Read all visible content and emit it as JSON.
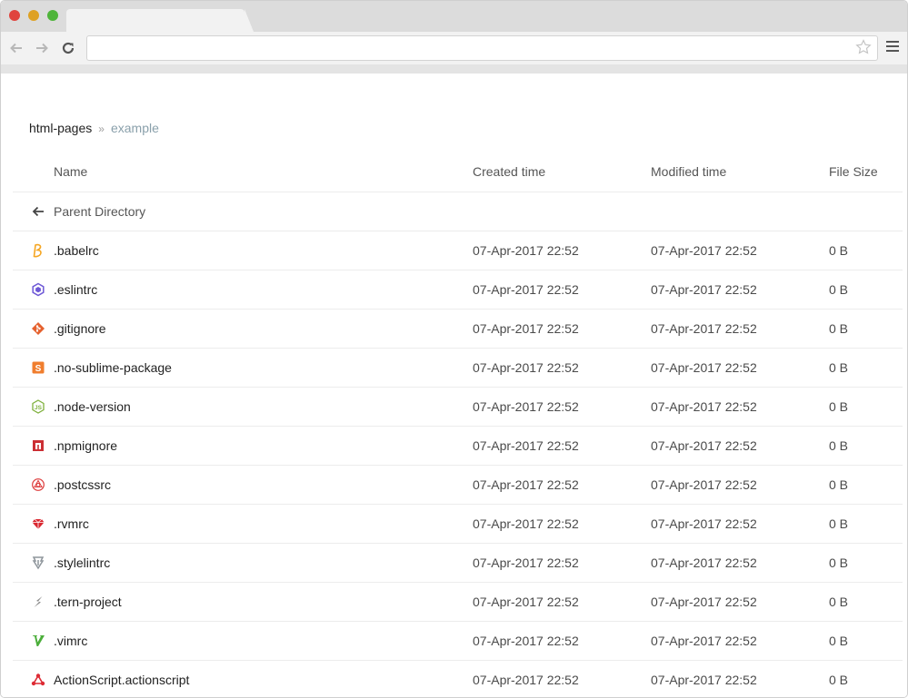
{
  "browser": {
    "url": "",
    "back_icon": "arrow-left-icon",
    "forward_icon": "arrow-right-icon",
    "reload_icon": "reload-icon",
    "star_icon": "star-icon",
    "menu_icon": "hamburger-menu-icon"
  },
  "breadcrumb": {
    "root": "html-pages",
    "separator": "»",
    "current": "example"
  },
  "table": {
    "headers": {
      "name": "Name",
      "created": "Created time",
      "modified": "Modified time",
      "size": "File Size"
    },
    "parent": {
      "label": "Parent Directory",
      "icon": "arrow-left-icon"
    },
    "rows": [
      {
        "name": ".babelrc",
        "created": "07-Apr-2017 22:52",
        "modified": "07-Apr-2017 22:52",
        "size": "0 B",
        "icon": "babel-icon",
        "color": "#f5a623"
      },
      {
        "name": ".eslintrc",
        "created": "07-Apr-2017 22:52",
        "modified": "07-Apr-2017 22:52",
        "size": "0 B",
        "icon": "eslint-icon",
        "color": "#6d58d6"
      },
      {
        "name": ".gitignore",
        "created": "07-Apr-2017 22:52",
        "modified": "07-Apr-2017 22:52",
        "size": "0 B",
        "icon": "git-icon",
        "color": "#e5612e"
      },
      {
        "name": ".no-sublime-package",
        "created": "07-Apr-2017 22:52",
        "modified": "07-Apr-2017 22:52",
        "size": "0 B",
        "icon": "sublime-icon",
        "color": "#f07e2e"
      },
      {
        "name": ".node-version",
        "created": "07-Apr-2017 22:52",
        "modified": "07-Apr-2017 22:52",
        "size": "0 B",
        "icon": "nodejs-icon",
        "color": "#7fb13d"
      },
      {
        "name": ".npmignore",
        "created": "07-Apr-2017 22:52",
        "modified": "07-Apr-2017 22:52",
        "size": "0 B",
        "icon": "npm-icon",
        "color": "#cb2f34"
      },
      {
        "name": ".postcssrc",
        "created": "07-Apr-2017 22:52",
        "modified": "07-Apr-2017 22:52",
        "size": "0 B",
        "icon": "postcss-icon",
        "color": "#dd3a3a"
      },
      {
        "name": ".rvmrc",
        "created": "07-Apr-2017 22:52",
        "modified": "07-Apr-2017 22:52",
        "size": "0 B",
        "icon": "ruby-icon",
        "color": "#d9262f"
      },
      {
        "name": ".stylelintrc",
        "created": "07-Apr-2017 22:52",
        "modified": "07-Apr-2017 22:52",
        "size": "0 B",
        "icon": "stylelint-icon",
        "color": "#8e959b"
      },
      {
        "name": ".tern-project",
        "created": "07-Apr-2017 22:52",
        "modified": "07-Apr-2017 22:52",
        "size": "0 B",
        "icon": "tern-icon",
        "color": "#8a8a8a"
      },
      {
        "name": ".vimrc",
        "created": "07-Apr-2017 22:52",
        "modified": "07-Apr-2017 22:52",
        "size": "0 B",
        "icon": "vim-icon",
        "color": "#4bae3a"
      },
      {
        "name": "ActionScript.actionscript",
        "created": "07-Apr-2017 22:52",
        "modified": "07-Apr-2017 22:52",
        "size": "0 B",
        "icon": "actionscript-icon",
        "color": "#dd2c35"
      }
    ]
  }
}
